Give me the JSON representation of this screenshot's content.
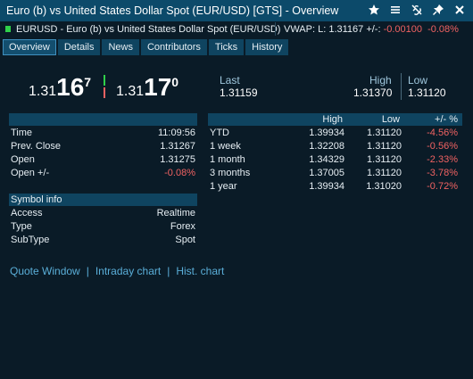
{
  "window": {
    "title": "Euro (b) vs United States Dollar Spot (EUR/USD) [GTS] - Overview",
    "icons": [
      "star-icon",
      "menu-icon",
      "unlink-icon",
      "pin-icon",
      "close-icon"
    ]
  },
  "infobar": {
    "symbol_text": "EURUSD - Euro (b) vs United States Dollar Spot (EUR/USD)",
    "vwap_text": "VWAP:  L: 1.31167  +/-:",
    "change": "-0.00100",
    "change_pct": "-0.08%"
  },
  "tabs": [
    "Overview",
    "Details",
    "News",
    "Contributors",
    "Ticks",
    "History"
  ],
  "quote": {
    "bid_small": "1.31",
    "bid_big": "16",
    "bid_sup": "7",
    "ask_small": "1.31",
    "ask_big": "17",
    "ask_sup": "0",
    "last_label": "Last",
    "last_value": "1.31159",
    "high_label": "High",
    "high_value": "1.31370",
    "low_label": "Low",
    "low_value": "1.31120"
  },
  "stats": {
    "rows": [
      {
        "label": "Time",
        "value": "11:09:56",
        "negative": false
      },
      {
        "label": "Prev. Close",
        "value": "1.31267",
        "negative": false
      },
      {
        "label": "Open",
        "value": "1.31275",
        "negative": false
      },
      {
        "label": "Open +/-",
        "value": "-0.08%",
        "negative": true
      }
    ]
  },
  "symbol_info": {
    "header": "Symbol info",
    "rows": [
      {
        "label": "Access",
        "value": "Realtime"
      },
      {
        "label": "Type",
        "value": "Forex"
      },
      {
        "label": "SubType",
        "value": "Spot"
      }
    ]
  },
  "performance": {
    "headers": [
      "High",
      "Low",
      "+/- %"
    ],
    "rows": [
      {
        "period": "YTD",
        "high": "1.39934",
        "low": "1.31120",
        "change": "-4.56%"
      },
      {
        "period": "1 week",
        "high": "1.32208",
        "low": "1.31120",
        "change": "-0.56%"
      },
      {
        "period": "1 month",
        "high": "1.34329",
        "low": "1.31120",
        "change": "-2.33%"
      },
      {
        "period": "3 months",
        "high": "1.37005",
        "low": "1.31120",
        "change": "-3.78%"
      },
      {
        "period": "1 year",
        "high": "1.39934",
        "low": "1.31020",
        "change": "-0.72%"
      }
    ]
  },
  "links": [
    "Quote Window",
    "Intraday chart",
    "Hist. chart"
  ],
  "colors": {
    "background": "#0a1b27",
    "titlebar": "#0c4a6a",
    "header": "#0f4460",
    "negative": "#f06262",
    "link": "#5aaed8",
    "status_green": "#2fd04a"
  }
}
